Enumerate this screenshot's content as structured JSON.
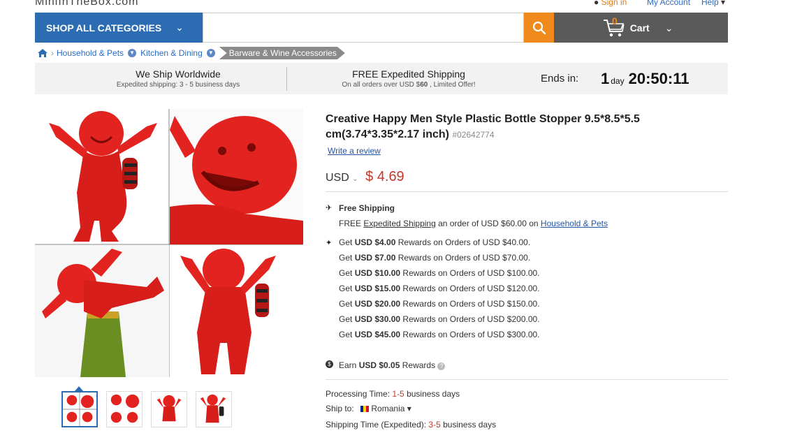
{
  "site": {
    "logo": "MiniInTheBox.com"
  },
  "top_links": {
    "sign_in": "Sign in",
    "my_account": "My Account",
    "help": "Help"
  },
  "header": {
    "categories_label": "SHOP ALL CATEGORIES",
    "search_value": "",
    "cart_count": "0",
    "cart_label": "Cart"
  },
  "breadcrumb": {
    "items": [
      "Household & Pets",
      "Kitchen & Dining",
      "Barware & Wine Accessories"
    ]
  },
  "banner": {
    "worldwide_title": "We Ship Worldwide",
    "worldwide_sub": "Expedited shipping: 3 - 5 business days",
    "free_title": "FREE Expedited Shipping",
    "free_sub_pre": "On all orders over USD $",
    "free_sub_amount": "60",
    "free_sub_post": ", Limited Offer!",
    "ends_label": "Ends in:",
    "days": "1",
    "day_label": "day",
    "time": "20:50:11"
  },
  "product": {
    "title": "Creative Happy Men Style Plastic Bottle Stopper 9.5*8.5*5.5 cm(3.74*3.35*2.17 inch)",
    "sku": "#02642774",
    "write_review": "Write a review",
    "currency": "USD",
    "price": "$ 4.69"
  },
  "shipping": {
    "label": "Free Shipping",
    "detail_pre": "FREE",
    "detail_link": "Expedited Shipping",
    "detail_mid": "an order of USD $60.00 on",
    "detail_cat": "Household & Pets"
  },
  "rewards": [
    {
      "pre": "Get",
      "amount": "USD $4.00",
      "post": "Rewards on Orders of USD $40.00."
    },
    {
      "pre": "Get",
      "amount": "USD $7.00",
      "post": "Rewards on Orders of USD $70.00."
    },
    {
      "pre": "Get",
      "amount": "USD $10.00",
      "post": "Rewards on Orders of USD $100.00."
    },
    {
      "pre": "Get",
      "amount": "USD $15.00",
      "post": "Rewards on Orders of USD $120.00."
    },
    {
      "pre": "Get",
      "amount": "USD $20.00",
      "post": "Rewards on Orders of USD $150.00."
    },
    {
      "pre": "Get",
      "amount": "USD $30.00",
      "post": "Rewards on Orders of USD $200.00."
    },
    {
      "pre": "Get",
      "amount": "USD $45.00",
      "post": "Rewards on Orders of USD $300.00."
    }
  ],
  "earn": {
    "pre": "Earn",
    "amount": "USD $0.05",
    "post": "Rewards"
  },
  "details": {
    "processing_label": "Processing Time:",
    "processing_value": "1-5",
    "processing_unit": "business days",
    "ship_to_label": "Ship to:",
    "ship_to_value": "Romania",
    "shipping_time_label": "Shipping Time (Expedited):",
    "shipping_time_value": "3-5",
    "shipping_time_unit": "business days"
  },
  "colors": {
    "brand_blue": "#2b6cb3",
    "search_orange": "#f08a1d",
    "price_red": "#c0392b",
    "product_red": "#e3231f"
  }
}
